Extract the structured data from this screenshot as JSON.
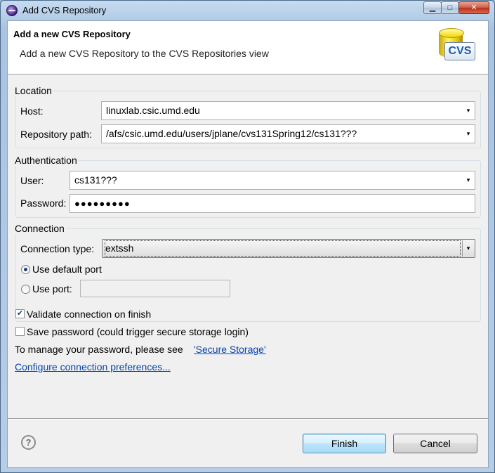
{
  "window": {
    "title": "Add CVS Repository",
    "minimize_glyph": "▁",
    "maximize_glyph": "□",
    "close_glyph": "✕"
  },
  "banner": {
    "title": "Add a new CVS Repository",
    "message": "Add a new CVS Repository to the CVS Repositories view",
    "icon_text": "CVS"
  },
  "location": {
    "group_label": "Location",
    "host_label": "Host:",
    "host_value": "linuxlab.csic.umd.edu",
    "path_label": "Repository path:",
    "path_value": "/afs/csic.umd.edu/users/jplane/cvs131Spring12/cs131???"
  },
  "authentication": {
    "group_label": "Authentication",
    "user_label": "User:",
    "user_value": "cs131???",
    "password_label": "Password:",
    "password_value": "●●●●●●●●●"
  },
  "connection": {
    "group_label": "Connection",
    "type_label": "Connection type:",
    "type_value": "extssh",
    "default_port_label": "Use default port",
    "use_port_label": "Use port:",
    "port_value": ""
  },
  "options": {
    "validate_label": "Validate connection on finish",
    "validate_checked": true,
    "save_password_label": "Save password (could trigger secure storage login)",
    "save_password_checked": false,
    "manage_text": "To manage your password, please see",
    "secure_storage_link": "'Secure Storage'",
    "configure_link": "Configure connection preferences..."
  },
  "buttons": {
    "finish": "Finish",
    "cancel": "Cancel",
    "help_glyph": "?"
  },
  "icons": {
    "dropdown_arrow": "▾",
    "check_glyph": "✔"
  }
}
